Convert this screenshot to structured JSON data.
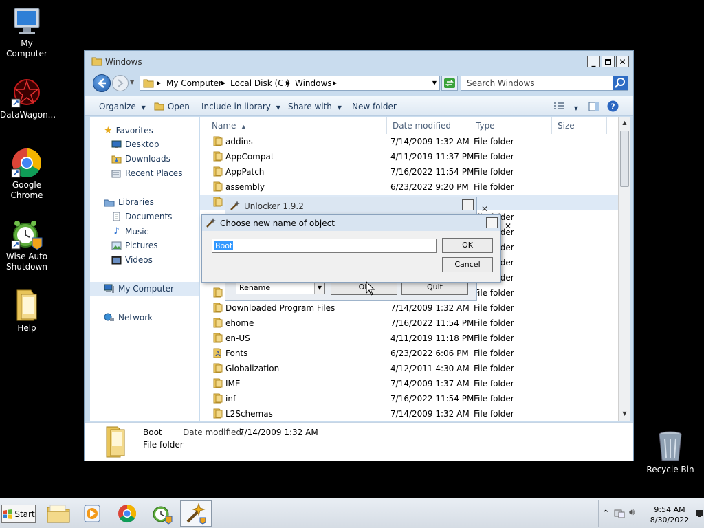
{
  "desktop": {
    "icons": [
      {
        "label": "My Computer"
      },
      {
        "label": "DataWagon..."
      },
      {
        "label": "Google Chrome"
      },
      {
        "label": "Wise Auto Shutdown"
      },
      {
        "label": "Help"
      },
      {
        "label": "Recycle Bin"
      }
    ]
  },
  "explorer": {
    "title": "Windows",
    "breadcrumb": [
      "My Computer",
      "Local Disk (C:)",
      "Windows"
    ],
    "search_placeholder": "Search Windows",
    "toolbar": {
      "organize": "Organize",
      "open": "Open",
      "include_in_library": "Include in library",
      "share_with": "Share with",
      "new_folder": "New folder"
    },
    "nav": {
      "favorites": "Favorites",
      "desktop": "Desktop",
      "downloads": "Downloads",
      "recent_places": "Recent Places",
      "libraries": "Libraries",
      "documents": "Documents",
      "music": "Music",
      "pictures": "Pictures",
      "videos": "Videos",
      "my_computer": "My Computer",
      "network": "Network"
    },
    "columns": {
      "name": "Name",
      "date_modified": "Date modified",
      "type": "Type",
      "size": "Size"
    },
    "rows": [
      {
        "name": "addins",
        "date": "7/14/2009 1:32 AM",
        "type": "File folder"
      },
      {
        "name": "AppCompat",
        "date": "4/11/2019 11:37 PM",
        "type": "File folder"
      },
      {
        "name": "AppPatch",
        "date": "7/16/2022 11:54 PM",
        "type": "File folder"
      },
      {
        "name": "assembly",
        "date": "6/23/2022 9:20 PM",
        "type": "File folder"
      },
      {
        "name": "",
        "date": "",
        "type": ""
      },
      {
        "name": "",
        "date": "",
        "type": "File folder"
      },
      {
        "name": "",
        "date": "",
        "type": "File folder"
      },
      {
        "name": "",
        "date": "",
        "type": "File folder"
      },
      {
        "name": "",
        "date": "",
        "type": "File folder"
      },
      {
        "name": "",
        "date": "",
        "type": "File folder"
      },
      {
        "name": "",
        "date": "",
        "type": "File folder"
      },
      {
        "name": "Downloaded Program Files",
        "date": "7/14/2009 1:32 AM",
        "type": "File folder"
      },
      {
        "name": "ehome",
        "date": "7/16/2022 11:54 PM",
        "type": "File folder"
      },
      {
        "name": "en-US",
        "date": "4/11/2019 11:18 PM",
        "type": "File folder"
      },
      {
        "name": "Fonts",
        "date": "6/23/2022 6:06 PM",
        "type": "File folder"
      },
      {
        "name": "Globalization",
        "date": "4/12/2011 4:30 AM",
        "type": "File folder"
      },
      {
        "name": "IME",
        "date": "7/14/2009 1:37 AM",
        "type": "File folder"
      },
      {
        "name": "inf",
        "date": "7/16/2022 11:54 PM",
        "type": "File folder"
      },
      {
        "name": "L2Schemas",
        "date": "7/14/2009 1:32 AM",
        "type": "File folder"
      }
    ],
    "details": {
      "name": "Boot",
      "date_label": "Date modified:",
      "date_value": "7/14/2009 1:32 AM",
      "type": "File folder"
    }
  },
  "unlocker": {
    "title": "Unlocker 1.9.2",
    "action_selected": "Rename",
    "ok_label": "OK",
    "quit_label": "Quit"
  },
  "rename_dialog": {
    "title": "Choose new name of object",
    "value": "Boot",
    "ok_label": "OK",
    "cancel_label": "Cancel"
  },
  "taskbar": {
    "start_label": "Start",
    "time": "9:54 AM",
    "date": "8/30/2022"
  },
  "colors": {
    "selection": "#3399ff",
    "window_frame": "#c9dcee",
    "folder": "#e8c45a"
  }
}
